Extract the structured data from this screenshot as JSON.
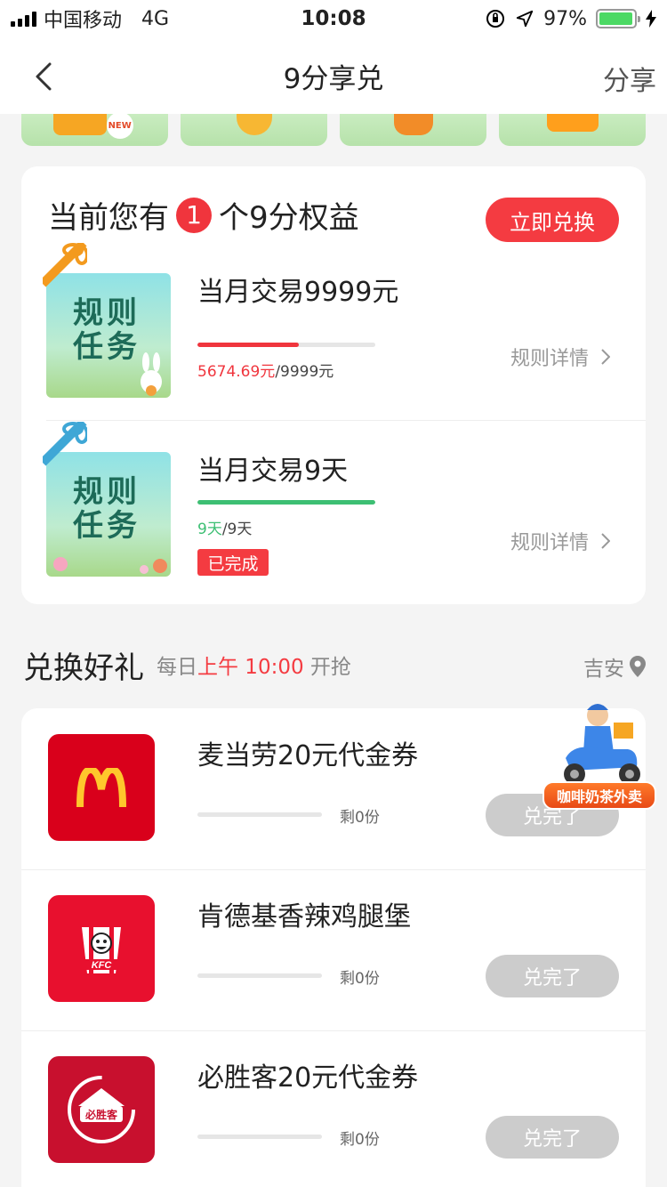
{
  "status_bar": {
    "carrier": "中国移动",
    "network": "4G",
    "time": "10:08",
    "battery": "97%",
    "battery_level": 0.97
  },
  "nav": {
    "title": "9分享兑",
    "share": "分享"
  },
  "rights": {
    "prefix": "当前您有",
    "count": "1",
    "suffix": "个9分权益",
    "redeem_button": "立即兑换",
    "tasks": [
      {
        "thumb_line1": "规则",
        "thumb_line2": "任务",
        "title": "当月交易9999元",
        "progress_current": "5674.69元",
        "progress_total": "/9999元",
        "progress_fraction": 0.5675,
        "progress_color": "#f0353d",
        "ribbon_color": "#f39a1e",
        "detail": "规则详情"
      },
      {
        "thumb_line1": "规则",
        "thumb_line2": "任务",
        "title": "当月交易9天",
        "progress_current": "9天",
        "progress_total": "/9天",
        "progress_fraction": 1.0,
        "progress_color": "#3dbf73",
        "ribbon_color": "#3fa7d6",
        "status_tag": "已完成",
        "detail": "规则详情"
      }
    ]
  },
  "gifts_section": {
    "title": "兑换好礼",
    "sub_prefix": "每日",
    "sub_highlight": "上午 10:00",
    "sub_suffix": "开抢",
    "location": "吉安"
  },
  "gifts": [
    {
      "name": "麦当劳20元代金券",
      "remaining": "剩0份",
      "button": "兑完了",
      "brand": "McDonald's",
      "logo_color": "#d9001b"
    },
    {
      "name": "肯德基香辣鸡腿堡",
      "remaining": "剩0份",
      "button": "兑完了",
      "brand": "KFC",
      "logo_color": "#e8102e"
    },
    {
      "name": "必胜客20元代金券",
      "remaining": "剩0份",
      "button": "兑完了",
      "brand": "必胜客",
      "logo_color": "#c8102e"
    }
  ],
  "float_badge": {
    "label": "咖啡奶茶外卖"
  },
  "icons": [
    "back-chevron-icon",
    "location-pin-icon",
    "chevron-right-icon",
    "gift-ribbon-icon",
    "signal-icon",
    "battery-icon"
  ]
}
